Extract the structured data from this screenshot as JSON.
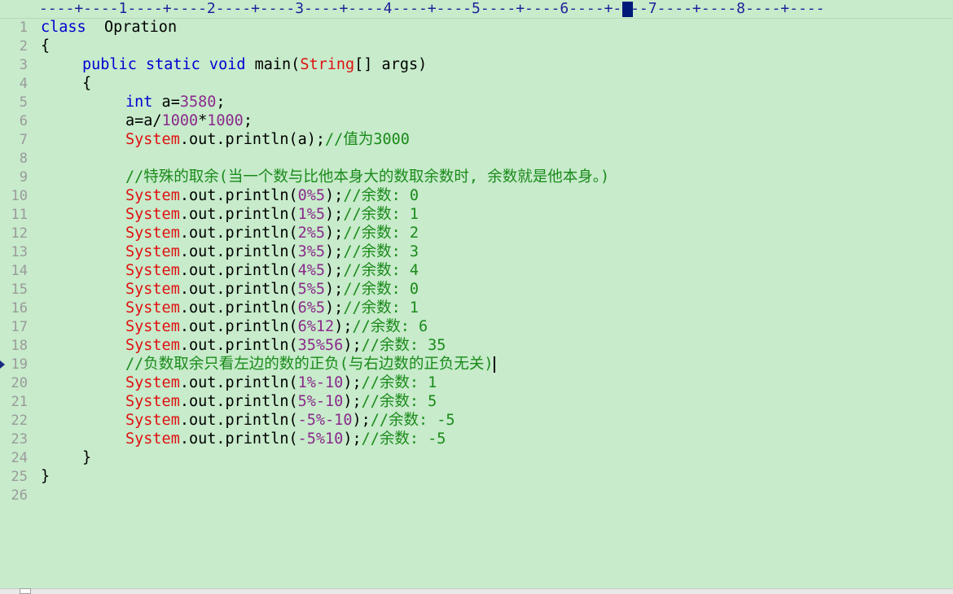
{
  "ruler": {
    "text": "----+----1----+----2----+----3----+----4----+----5----+----6----+----7----+----8----+----"
  },
  "line_numbers": [
    "1",
    "2",
    "3",
    "4",
    "5",
    "6",
    "7",
    "8",
    "9",
    "10",
    "11",
    "12",
    "13",
    "14",
    "15",
    "16",
    "17",
    "18",
    "19",
    "20",
    "21",
    "22",
    "23",
    "24",
    "25",
    "26"
  ],
  "code": {
    "l1": {
      "kw": "class",
      "rest": "  Opration"
    },
    "l2": {
      "text": "{"
    },
    "l3": {
      "kw1": "public static void",
      "mid": " main(",
      "cls": "String",
      "rest": "[] args)"
    },
    "l4": {
      "text": "{"
    },
    "l5": {
      "kw": "int",
      "mid": " a=",
      "num": "3580",
      "rest": ";"
    },
    "l6": {
      "p1": "a=a/",
      "n1": "1000",
      "p2": "*",
      "n2": "1000",
      "p3": ";"
    },
    "l7": {
      "cls": "System",
      "mid": ".out.println(a);",
      "cmt": "//值为3000"
    },
    "l8": {
      "text": ""
    },
    "l9": {
      "cmt": "//特殊的取余(当一个数与比他本身大的数取余数时, 余数就是他本身。)"
    },
    "l10": {
      "cls": "System",
      "mid": ".out.println(",
      "num": "0%5",
      "rest": ");",
      "cmt": "//余数: 0"
    },
    "l11": {
      "cls": "System",
      "mid": ".out.println(",
      "num": "1%5",
      "rest": ");",
      "cmt": "//余数: 1"
    },
    "l12": {
      "cls": "System",
      "mid": ".out.println(",
      "num": "2%5",
      "rest": ");",
      "cmt": "//余数: 2"
    },
    "l13": {
      "cls": "System",
      "mid": ".out.println(",
      "num": "3%5",
      "rest": ");",
      "cmt": "//余数: 3"
    },
    "l14": {
      "cls": "System",
      "mid": ".out.println(",
      "num": "4%5",
      "rest": ");",
      "cmt": "//余数: 4"
    },
    "l15": {
      "cls": "System",
      "mid": ".out.println(",
      "num": "5%5",
      "rest": ");",
      "cmt": "//余数: 0"
    },
    "l16": {
      "cls": "System",
      "mid": ".out.println(",
      "num": "6%5",
      "rest": ");",
      "cmt": "//余数: 1"
    },
    "l17": {
      "cls": "System",
      "mid": ".out.println(",
      "num": "6%12",
      "rest": ");",
      "cmt": "//余数: 6"
    },
    "l18": {
      "cls": "System",
      "mid": ".out.println(",
      "num": "35%56",
      "rest": ");",
      "cmt": "//余数: 35"
    },
    "l19": {
      "cmt": "//负数取余只看左边的数的正负(与右边数的正负无关)"
    },
    "l20": {
      "cls": "System",
      "mid": ".out.println(",
      "num": "1%-10",
      "rest": ");",
      "cmt": "//余数: 1"
    },
    "l21": {
      "cls": "System",
      "mid": ".out.println(",
      "num": "5%-10",
      "rest": ");",
      "cmt": "//余数: 5"
    },
    "l22": {
      "cls": "System",
      "mid": ".out.println(",
      "num": "-5%-10",
      "rest": ");",
      "cmt": "//余数: -5"
    },
    "l23": {
      "cls": "System",
      "mid": ".out.println(",
      "num": "-5%10",
      "rest": ");",
      "cmt": "//余数: -5"
    },
    "l24": {
      "text": "}"
    },
    "l25": {
      "text": "}"
    },
    "l26": {
      "text": ""
    }
  },
  "colors": {
    "background": "#c7ebcb",
    "keyword": "#0000d0",
    "class_name": "#e01010",
    "number": "#8b2a8b",
    "comment": "#1a8a1a",
    "line_number": "#9a9a9a"
  }
}
